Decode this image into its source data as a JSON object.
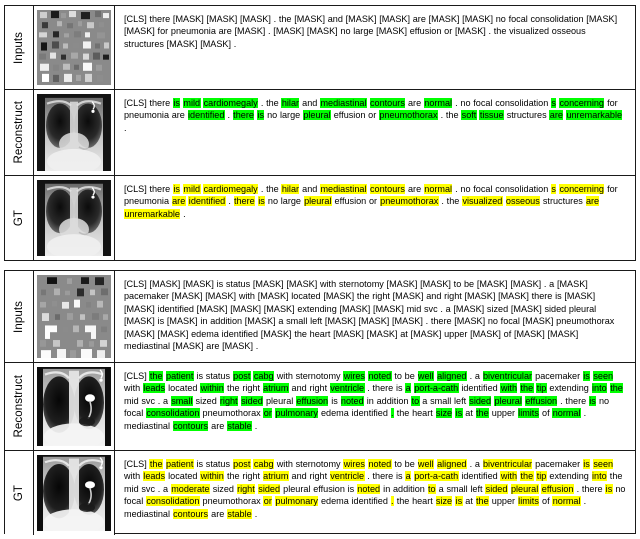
{
  "figure": {
    "row_labels": {
      "inputs": "Inputs",
      "reconstruct": "Reconstruct",
      "gt": "GT"
    },
    "colors": {
      "highlight_reconstruct": "#00FF00",
      "highlight_gt": "#FFFF00",
      "border": "#1A1A1A",
      "masked_patch_background": "#8A8A8A"
    }
  },
  "blocks": [
    {
      "id": "block-1",
      "rows": [
        {
          "label": "Inputs",
          "image": "masked-patch-image",
          "text_plain": "[CLS] there [MASK] [MASK] [MASK] . the [MASK] and [MASK] [MASK] are [MASK] [MASK] no focal consolidation [MASK] [MASK] for pneumonia are [MASK] . [MASK] [MASK] no large [MASK] effusion or [MASK] . the visualized osseous structures [MASK] [MASK] ."
        },
        {
          "label": "Reconstruct",
          "image": "chest-xray-reconstructed",
          "text_plain": "[CLS] there is mild cardiomegaly . the hilar and mediastinal contours are normal . no focal consolidation s concerning for pneumonia are identified . there is no large pleural effusion or pneumothorax . the soft tissue structures are unremarkable ."
        },
        {
          "label": "GT",
          "image": "chest-xray-ground-truth",
          "text_plain": "[CLS] there is mild cardiomegaly . the hilar and mediastinal contours are normal . no focal consolidation s concerning for pneumonia are identified . there is no large pleural effusion or pneumothorax . the visualized osseous structures are unremarkable ."
        }
      ]
    },
    {
      "id": "block-2",
      "rows": [
        {
          "label": "Inputs",
          "image": "masked-patch-image",
          "text_plain": "[CLS] [MASK] [MASK] is status [MASK] [MASK] with sternotomy [MASK] [MASK] to be [MASK] [MASK] . a [MASK] pacemaker [MASK] [MASK] with [MASK] located [MASK] the right [MASK] and right [MASK] [MASK] there is [MASK] [MASK] identified [MASK] [MASK] [MASK] extending [MASK] [MASK] mid svc . a [MASK] sized [MASK] sided pleural [MASK] is [MASK] in addition [MASK] a small left [MASK] [MASK] [MASK] . there [MASK] no focal [MASK] pneumothorax [MASK] [MASK] edema identified [MASK] the heart [MASK] [MASK] at [MASK] upper [MASK] of [MASK] [MASK] mediastinal [MASK] are [MASK] ."
        },
        {
          "label": "Reconstruct",
          "image": "chest-xray-reconstructed",
          "text_plain": "[CLS] the patient is status post cabg with sternotomy wires noted to be well aligned . a biventricular pacemaker is seen with leads located within the right atrium and right ventricle . there is a port-a-cath identified with the tip extending into the mid svc . a small sized right sided pleural effusion is noted in addition to a small left sided pleural effusion . there is no focal consolidation pneumothorax or pulmonary edema identified . the heart size is at the upper limits of normal . mediastinal contours are stable ."
        },
        {
          "label": "GT",
          "image": "chest-xray-ground-truth",
          "text_plain": "[CLS] the patient is status post cabg with sternotomy wires noted to be well aligned . a biventricular pacemaker is seen with leads located within the right atrium and right ventricle . there is a port-a-cath identified with the tip extending into the mid svc . a moderate sized right sided pleural effusion is noted in addition to a small left sided pleural effusion . there is no focal consolidation pneumothorax or pulmonary edema identified . the heart size is at the upper limits of normal . mediastinal contours are stable ."
        }
      ]
    }
  ],
  "rich_text": {
    "b1_inputs": [
      {
        "t": "[CLS] there [MASK] [MASK] [MASK] . the [MASK] and [MASK] [MASK] are [MASK] [MASK] no focal consolidation [MASK] [MASK] for pneumonia are [MASK] . [MASK] [MASK] no large [MASK] effusion or [MASK] . the visualized osseous structures [MASK] [MASK] .",
        "h": ""
      }
    ],
    "b1_recon": [
      {
        "t": "[CLS] there ",
        "h": ""
      },
      {
        "t": "is",
        "h": "g"
      },
      {
        "t": " ",
        "h": ""
      },
      {
        "t": "mild",
        "h": "g"
      },
      {
        "t": " ",
        "h": ""
      },
      {
        "t": "cardiomegaly",
        "h": "g"
      },
      {
        "t": " . the ",
        "h": ""
      },
      {
        "t": "hilar",
        "h": "g"
      },
      {
        "t": " and ",
        "h": ""
      },
      {
        "t": "mediastinal",
        "h": "g"
      },
      {
        "t": " ",
        "h": ""
      },
      {
        "t": "contours",
        "h": "g"
      },
      {
        "t": " are ",
        "h": ""
      },
      {
        "t": "normal",
        "h": "g"
      },
      {
        "t": " . no focal consolidation ",
        "h": ""
      },
      {
        "t": "s",
        "h": "g"
      },
      {
        "t": " ",
        "h": ""
      },
      {
        "t": "concerning",
        "h": "g"
      },
      {
        "t": " for pneumonia are ",
        "h": ""
      },
      {
        "t": "identified",
        "h": "g"
      },
      {
        "t": " . ",
        "h": ""
      },
      {
        "t": "there",
        "h": "g"
      },
      {
        "t": " ",
        "h": ""
      },
      {
        "t": "is",
        "h": "g"
      },
      {
        "t": " no large ",
        "h": ""
      },
      {
        "t": "pleural",
        "h": "g"
      },
      {
        "t": " effusion or ",
        "h": ""
      },
      {
        "t": "pneumothorax",
        "h": "g"
      },
      {
        "t": " . the ",
        "h": ""
      },
      {
        "t": "soft",
        "h": "g"
      },
      {
        "t": " ",
        "h": ""
      },
      {
        "t": "tissue",
        "h": "g"
      },
      {
        "t": " structures ",
        "h": ""
      },
      {
        "t": "are",
        "h": "g"
      },
      {
        "t": " ",
        "h": ""
      },
      {
        "t": "unremarkable",
        "h": "g"
      },
      {
        "t": " .",
        "h": ""
      }
    ],
    "b1_gt": [
      {
        "t": "[CLS] there ",
        "h": ""
      },
      {
        "t": "is",
        "h": "y"
      },
      {
        "t": " ",
        "h": ""
      },
      {
        "t": "mild",
        "h": "y"
      },
      {
        "t": " ",
        "h": ""
      },
      {
        "t": "cardiomegaly",
        "h": "y"
      },
      {
        "t": " . the ",
        "h": ""
      },
      {
        "t": "hilar",
        "h": "y"
      },
      {
        "t": " and ",
        "h": ""
      },
      {
        "t": "mediastinal",
        "h": "y"
      },
      {
        "t": " ",
        "h": ""
      },
      {
        "t": "contours",
        "h": "y"
      },
      {
        "t": " are ",
        "h": ""
      },
      {
        "t": "normal",
        "h": "y"
      },
      {
        "t": " . no focal consolidation ",
        "h": ""
      },
      {
        "t": "s",
        "h": "y"
      },
      {
        "t": " ",
        "h": ""
      },
      {
        "t": "concerning",
        "h": "y"
      },
      {
        "t": " for pneumonia ",
        "h": ""
      },
      {
        "t": "are",
        "h": "y"
      },
      {
        "t": " ",
        "h": ""
      },
      {
        "t": "identified",
        "h": "y"
      },
      {
        "t": " . ",
        "h": ""
      },
      {
        "t": "there",
        "h": "y"
      },
      {
        "t": " ",
        "h": ""
      },
      {
        "t": "is",
        "h": "y"
      },
      {
        "t": " no large ",
        "h": ""
      },
      {
        "t": "pleural",
        "h": "y"
      },
      {
        "t": " effusion or ",
        "h": ""
      },
      {
        "t": "pneumothorax",
        "h": "y"
      },
      {
        "t": " . the ",
        "h": ""
      },
      {
        "t": "visualized",
        "h": "y"
      },
      {
        "t": " ",
        "h": ""
      },
      {
        "t": "osseous",
        "h": "y"
      },
      {
        "t": " structures ",
        "h": ""
      },
      {
        "t": "are",
        "h": "y"
      },
      {
        "t": " ",
        "h": ""
      },
      {
        "t": "unremarkable",
        "h": "y"
      },
      {
        "t": " .",
        "h": ""
      }
    ],
    "b2_inputs": [
      {
        "t": "[CLS] [MASK] [MASK] is status [MASK] [MASK] with sternotomy [MASK] [MASK] to be [MASK] [MASK] . a [MASK] pacemaker [MASK] [MASK] with [MASK] located [MASK] the right [MASK] and right [MASK] [MASK] there is [MASK] [MASK] identified [MASK] [MASK] [MASK] extending [MASK] [MASK] mid svc . a [MASK] sized [MASK] sided pleural [MASK] is [MASK] in addition [MASK] a small left [MASK] [MASK] [MASK] . there [MASK] no focal [MASK] pneumothorax [MASK] [MASK] edema identified [MASK] the heart [MASK] [MASK] at [MASK] upper [MASK] of [MASK] [MASK] mediastinal [MASK] are [MASK] .",
        "h": ""
      }
    ],
    "b2_recon": [
      {
        "t": "[CLS] ",
        "h": ""
      },
      {
        "t": "the",
        "h": "g"
      },
      {
        "t": " ",
        "h": ""
      },
      {
        "t": "patient",
        "h": "g"
      },
      {
        "t": " is status ",
        "h": ""
      },
      {
        "t": "post",
        "h": "g"
      },
      {
        "t": " ",
        "h": ""
      },
      {
        "t": "cabg",
        "h": "g"
      },
      {
        "t": " with sternotomy ",
        "h": ""
      },
      {
        "t": "wires",
        "h": "g"
      },
      {
        "t": " ",
        "h": ""
      },
      {
        "t": "noted",
        "h": "g"
      },
      {
        "t": " to be ",
        "h": ""
      },
      {
        "t": "well",
        "h": "g"
      },
      {
        "t": " ",
        "h": ""
      },
      {
        "t": "aligned",
        "h": "g"
      },
      {
        "t": " . a ",
        "h": ""
      },
      {
        "t": "biventricular",
        "h": "g"
      },
      {
        "t": " pacemaker ",
        "h": ""
      },
      {
        "t": "is",
        "h": "g"
      },
      {
        "t": " ",
        "h": ""
      },
      {
        "t": "seen",
        "h": "g"
      },
      {
        "t": " with ",
        "h": ""
      },
      {
        "t": "leads",
        "h": "g"
      },
      {
        "t": " located ",
        "h": ""
      },
      {
        "t": "within",
        "h": "g"
      },
      {
        "t": " the right ",
        "h": ""
      },
      {
        "t": "atrium",
        "h": "g"
      },
      {
        "t": " and right ",
        "h": ""
      },
      {
        "t": "ventricle",
        "h": "g"
      },
      {
        "t": " . there is ",
        "h": ""
      },
      {
        "t": "a",
        "h": "g"
      },
      {
        "t": " ",
        "h": ""
      },
      {
        "t": "port-a-cath",
        "h": "g"
      },
      {
        "t": " identified ",
        "h": ""
      },
      {
        "t": "with",
        "h": "g"
      },
      {
        "t": " ",
        "h": ""
      },
      {
        "t": "the",
        "h": "g"
      },
      {
        "t": " ",
        "h": ""
      },
      {
        "t": "tip",
        "h": "g"
      },
      {
        "t": " extending ",
        "h": ""
      },
      {
        "t": "into",
        "h": "g"
      },
      {
        "t": " ",
        "h": ""
      },
      {
        "t": "the",
        "h": "g"
      },
      {
        "t": " mid svc . a ",
        "h": ""
      },
      {
        "t": "small",
        "h": "g"
      },
      {
        "t": " sized ",
        "h": ""
      },
      {
        "t": "right",
        "h": "g"
      },
      {
        "t": " ",
        "h": ""
      },
      {
        "t": "sided",
        "h": "g"
      },
      {
        "t": " pleural ",
        "h": ""
      },
      {
        "t": "effusion",
        "h": "g"
      },
      {
        "t": " is ",
        "h": ""
      },
      {
        "t": "noted",
        "h": "g"
      },
      {
        "t": " in addition ",
        "h": ""
      },
      {
        "t": "to",
        "h": "g"
      },
      {
        "t": " a small left ",
        "h": ""
      },
      {
        "t": "sided",
        "h": "g"
      },
      {
        "t": " ",
        "h": ""
      },
      {
        "t": "pleural",
        "h": "g"
      },
      {
        "t": " ",
        "h": ""
      },
      {
        "t": "effusion",
        "h": "g"
      },
      {
        "t": " . there ",
        "h": ""
      },
      {
        "t": "is",
        "h": "g"
      },
      {
        "t": " no focal ",
        "h": ""
      },
      {
        "t": "consolidation",
        "h": "g"
      },
      {
        "t": " pneumothorax ",
        "h": ""
      },
      {
        "t": "or",
        "h": "g"
      },
      {
        "t": " ",
        "h": ""
      },
      {
        "t": "pulmonary",
        "h": "g"
      },
      {
        "t": " edema identified ",
        "h": ""
      },
      {
        "t": ".",
        "h": "g"
      },
      {
        "t": " the heart ",
        "h": ""
      },
      {
        "t": "size",
        "h": "g"
      },
      {
        "t": " ",
        "h": ""
      },
      {
        "t": "is",
        "h": "g"
      },
      {
        "t": " at ",
        "h": ""
      },
      {
        "t": "the",
        "h": "g"
      },
      {
        "t": " upper ",
        "h": ""
      },
      {
        "t": "limits",
        "h": "g"
      },
      {
        "t": " of ",
        "h": ""
      },
      {
        "t": "normal",
        "h": "g"
      },
      {
        "t": " . mediastinal ",
        "h": ""
      },
      {
        "t": "contours",
        "h": "g"
      },
      {
        "t": " are ",
        "h": ""
      },
      {
        "t": "stable",
        "h": "g"
      },
      {
        "t": " .",
        "h": ""
      }
    ],
    "b2_gt": [
      {
        "t": "[CLS] ",
        "h": ""
      },
      {
        "t": "the",
        "h": "y"
      },
      {
        "t": " ",
        "h": ""
      },
      {
        "t": "patient",
        "h": "y"
      },
      {
        "t": " is status ",
        "h": ""
      },
      {
        "t": "post",
        "h": "y"
      },
      {
        "t": " ",
        "h": ""
      },
      {
        "t": "cabg",
        "h": "y"
      },
      {
        "t": " with sternotomy ",
        "h": ""
      },
      {
        "t": "wires",
        "h": "y"
      },
      {
        "t": " ",
        "h": ""
      },
      {
        "t": "noted",
        "h": "y"
      },
      {
        "t": " to be ",
        "h": ""
      },
      {
        "t": "well",
        "h": "y"
      },
      {
        "t": " ",
        "h": ""
      },
      {
        "t": "aligned",
        "h": "y"
      },
      {
        "t": " . a ",
        "h": ""
      },
      {
        "t": "biventricular",
        "h": "y"
      },
      {
        "t": " pacemaker ",
        "h": ""
      },
      {
        "t": "is",
        "h": "y"
      },
      {
        "t": " ",
        "h": ""
      },
      {
        "t": "seen",
        "h": "y"
      },
      {
        "t": " with ",
        "h": ""
      },
      {
        "t": "leads",
        "h": "y"
      },
      {
        "t": " located ",
        "h": ""
      },
      {
        "t": "within",
        "h": "y"
      },
      {
        "t": " the right ",
        "h": ""
      },
      {
        "t": "atrium",
        "h": "y"
      },
      {
        "t": " and right ",
        "h": ""
      },
      {
        "t": "ventricle",
        "h": "y"
      },
      {
        "t": " . there is ",
        "h": ""
      },
      {
        "t": "a",
        "h": "y"
      },
      {
        "t": " ",
        "h": ""
      },
      {
        "t": "port-a-cath",
        "h": "y"
      },
      {
        "t": " identified ",
        "h": ""
      },
      {
        "t": "with",
        "h": "y"
      },
      {
        "t": " ",
        "h": ""
      },
      {
        "t": "the",
        "h": "y"
      },
      {
        "t": " ",
        "h": ""
      },
      {
        "t": "tip",
        "h": "y"
      },
      {
        "t": " extending ",
        "h": ""
      },
      {
        "t": "into",
        "h": "y"
      },
      {
        "t": " the mid svc . a ",
        "h": ""
      },
      {
        "t": "moderate",
        "h": "y"
      },
      {
        "t": " sized ",
        "h": ""
      },
      {
        "t": "right",
        "h": "y"
      },
      {
        "t": " ",
        "h": ""
      },
      {
        "t": "sided",
        "h": "y"
      },
      {
        "t": " pleural effusion is ",
        "h": ""
      },
      {
        "t": "noted",
        "h": "y"
      },
      {
        "t": " in addition ",
        "h": ""
      },
      {
        "t": "to",
        "h": "y"
      },
      {
        "t": " a small left ",
        "h": ""
      },
      {
        "t": "sided",
        "h": "y"
      },
      {
        "t": " ",
        "h": ""
      },
      {
        "t": "pleural",
        "h": "y"
      },
      {
        "t": " ",
        "h": ""
      },
      {
        "t": "effusion",
        "h": "y"
      },
      {
        "t": " . there ",
        "h": ""
      },
      {
        "t": "is",
        "h": "y"
      },
      {
        "t": " no focal ",
        "h": ""
      },
      {
        "t": "consolidation",
        "h": "y"
      },
      {
        "t": " pneumothorax ",
        "h": ""
      },
      {
        "t": "or",
        "h": "y"
      },
      {
        "t": " ",
        "h": ""
      },
      {
        "t": "pulmonary",
        "h": "y"
      },
      {
        "t": " edema identified ",
        "h": ""
      },
      {
        "t": ".",
        "h": "y"
      },
      {
        "t": " the heart ",
        "h": ""
      },
      {
        "t": "size",
        "h": "y"
      },
      {
        "t": " ",
        "h": ""
      },
      {
        "t": "is",
        "h": "y"
      },
      {
        "t": " at ",
        "h": ""
      },
      {
        "t": "the",
        "h": "y"
      },
      {
        "t": " upper ",
        "h": ""
      },
      {
        "t": "limits",
        "h": "y"
      },
      {
        "t": " of ",
        "h": ""
      },
      {
        "t": "normal",
        "h": "y"
      },
      {
        "t": " . mediastinal ",
        "h": ""
      },
      {
        "t": "contours",
        "h": "y"
      },
      {
        "t": " are ",
        "h": ""
      },
      {
        "t": "stable",
        "h": "y"
      },
      {
        "t": " .",
        "h": ""
      }
    ]
  }
}
